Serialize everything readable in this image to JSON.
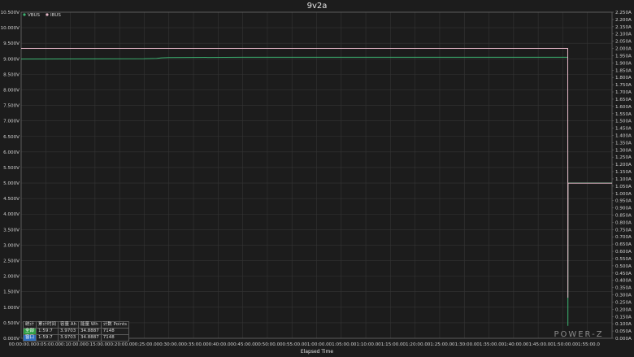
{
  "chart_data": {
    "type": "line",
    "title": "9v2a",
    "xlabel": "Elapsed Time",
    "x_range_seconds": [
      0,
      7200
    ],
    "x_ticks": [
      "00:00:00.0",
      "00:05:00.0",
      "00:10:00.0",
      "00:15:00.0",
      "00:20:00.0",
      "00:25:00.0",
      "00:30:00.0",
      "00:35:00.0",
      "00:40:00.0",
      "00:45:00.0",
      "00:50:00.0",
      "00:55:00.0",
      "01:00:00.0",
      "01:05:00.0",
      "01:10:00.0",
      "01:15:00.0",
      "01:20:00.0",
      "01:25:00.0",
      "01:30:00.0",
      "01:35:00.0",
      "01:40:00.0",
      "01:45:00.0",
      "01:50:00.0",
      "01:55:00.0"
    ],
    "y_left": {
      "unit": "V",
      "min": 0,
      "max": 10.5,
      "step": 0.5,
      "ticks": [
        "0.000V",
        "0.500V",
        "1.000V",
        "1.500V",
        "2.000V",
        "2.500V",
        "3.000V",
        "3.500V",
        "4.000V",
        "4.500V",
        "5.000V",
        "5.500V",
        "6.000V",
        "6.500V",
        "7.000V",
        "7.500V",
        "8.000V",
        "8.500V",
        "9.000V",
        "9.500V",
        "10.000V",
        "10.500V"
      ]
    },
    "y_right": {
      "unit": "A",
      "min": 0,
      "max": 2.25,
      "step": 0.05,
      "ticks": [
        "0.000A",
        "0.050A",
        "0.100A",
        "0.150A",
        "0.200A",
        "0.250A",
        "0.300A",
        "0.350A",
        "0.400A",
        "0.450A",
        "0.500A",
        "0.550A",
        "0.600A",
        "0.650A",
        "0.700A",
        "0.750A",
        "0.800A",
        "0.850A",
        "0.900A",
        "0.950A",
        "1.000A",
        "1.050A",
        "1.100A",
        "1.150A",
        "1.200A",
        "1.250A",
        "1.300A",
        "1.350A",
        "1.400A",
        "1.450A",
        "1.500A",
        "1.550A",
        "1.600A",
        "1.650A",
        "1.700A",
        "1.750A",
        "1.800A",
        "1.850A",
        "1.900A",
        "1.950A",
        "2.000A",
        "2.050A",
        "2.100A",
        "2.150A",
        "2.200A",
        "2.250A"
      ]
    },
    "grid": true,
    "legend_position": "top-left",
    "series": [
      {
        "name": "VBUS",
        "axis": "left",
        "color": "#3cb371",
        "points": [
          [
            0,
            8.99
          ],
          [
            1500,
            9.0
          ],
          [
            1650,
            9.01
          ],
          [
            1710,
            9.03
          ],
          [
            1800,
            9.04
          ],
          [
            2700,
            9.05
          ],
          [
            4500,
            9.05
          ],
          [
            6600,
            9.05
          ],
          [
            6660,
            9.05
          ],
          [
            6662,
            0.4
          ],
          [
            6664,
            5.0
          ],
          [
            7200,
            5.0
          ]
        ]
      },
      {
        "name": "IBUS",
        "axis": "right",
        "color": "#e6b8c8",
        "points": [
          [
            0,
            2.0
          ],
          [
            6660,
            2.0
          ],
          [
            6662,
            0.28
          ],
          [
            6664,
            1.07
          ],
          [
            7200,
            1.07
          ]
        ]
      }
    ]
  },
  "stats_table": {
    "header": [
      "统计",
      "累计时间",
      "容量 Ah",
      "能量 Wh",
      "计数 Points"
    ],
    "rows": [
      [
        "全部",
        "1:59:7",
        "3.9703",
        "34.8887",
        "7148"
      ],
      [
        "窗口",
        "1:59:7",
        "3.9703",
        "34.8887",
        "7148"
      ]
    ]
  },
  "brand": "POWER-Z",
  "colors": {
    "background": "#1c1c1c",
    "grid": "#353535",
    "axis": "#6a6a6a",
    "vbus": "#3cb371",
    "ibus": "#e6b8c8"
  }
}
